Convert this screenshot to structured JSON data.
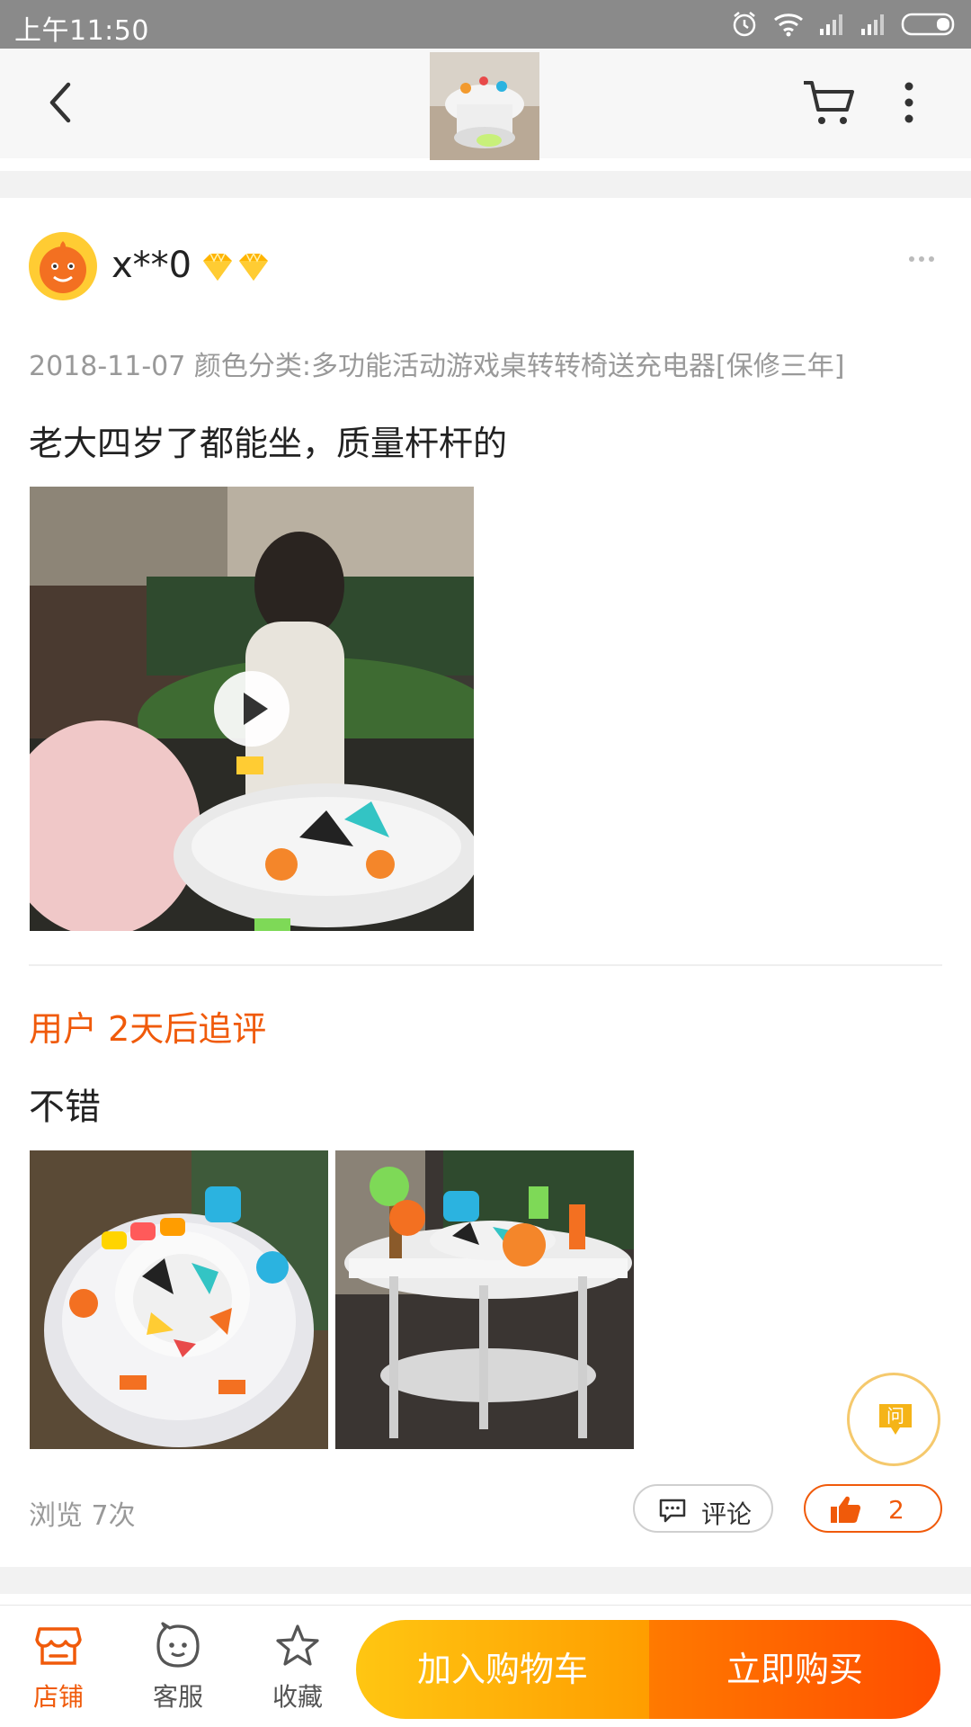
{
  "status_bar": {
    "time": "上午11:50",
    "icons": [
      "alarm-icon",
      "wifi-icon",
      "signal-icon",
      "signal-icon",
      "battery-icon"
    ]
  },
  "nav": {
    "back_icon": "chevron-left-icon",
    "cart_icon": "cart-icon",
    "more_icon": "more-vertical-icon"
  },
  "review": {
    "username": "x**0",
    "badge_icons": [
      "diamond-icon",
      "diamond-icon"
    ],
    "meta": "2018-11-07 颜色分类:多功能活动游戏桌转转椅送充电器[保修三年]",
    "text": "老大四岁了都能坐，质量杆杆的",
    "video_icon": "play-icon",
    "followup": {
      "label": "用户 2天后追评",
      "text": "不错"
    },
    "views": "浏览 7次",
    "comment_label": "评论",
    "like_count": "2"
  },
  "floating": {
    "ask_label": "问"
  },
  "bottom_bar": {
    "tabs": [
      {
        "label": "店铺",
        "icon": "store-icon"
      },
      {
        "label": "客服",
        "icon": "service-icon"
      },
      {
        "label": "收藏",
        "icon": "star-icon"
      }
    ],
    "add_to_cart": "加入购物车",
    "buy_now": "立即购买"
  },
  "colors": {
    "accent": "#f05a0a",
    "cart_gradient": [
      "#ffc612",
      "#ff9d00"
    ],
    "buy_gradient": [
      "#ff7a00",
      "#ff4d00"
    ]
  }
}
